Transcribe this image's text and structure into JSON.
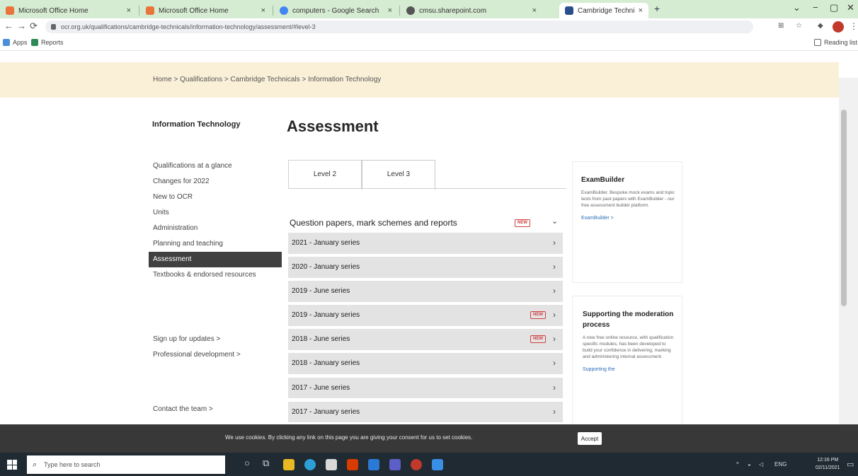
{
  "browser": {
    "tabs": [
      {
        "label": "Microsoft Office Home",
        "fav_color": "#e8743b",
        "active": false
      },
      {
        "label": "Microsoft Office Home",
        "fav_color": "#e8743b",
        "active": false
      },
      {
        "label": "computers - Google Search",
        "fav_color": "#4285f4",
        "active": false
      },
      {
        "label": "cmsu.sharepoint.com",
        "fav_color": "#555555",
        "active": false
      },
      {
        "label": "Cambridge Technicals - Informa",
        "fav_color": "#2b4e8c",
        "active": true
      }
    ],
    "close_glyph": "×",
    "new_tab_glyph": "+",
    "address": "ocr.org.uk/qualifications/cambridge-technicals/information-technology/assessment/#level-3",
    "bookmarks": [
      {
        "label": "Apps",
        "icon": "apps-grid-icon"
      },
      {
        "label": "Reports",
        "icon": "reports-icon"
      }
    ],
    "reading_list": "Reading list"
  },
  "page": {
    "breadcrumb": "Home > Qualifications > Cambridge Technicals > Information Technology",
    "sidenav_title": "Information Technology",
    "sidenav_items": [
      {
        "label": "Qualifications at a glance",
        "active": false
      },
      {
        "label": "Changes for 2022",
        "active": false
      },
      {
        "label": "New to OCR",
        "active": false
      },
      {
        "label": "Units",
        "active": false
      },
      {
        "label": "Administration",
        "active": false
      },
      {
        "label": "Planning and teaching",
        "active": false
      },
      {
        "label": "Assessment",
        "active": true
      },
      {
        "label": "Textbooks & endorsed resources",
        "active": false
      }
    ],
    "side_links": [
      "Sign up for updates >",
      "Professional development >",
      "Contact the team >"
    ],
    "title": "Assessment",
    "level_tabs": [
      {
        "label": "Level 2",
        "active": false
      },
      {
        "label": "Level 3",
        "active": true
      }
    ],
    "section_header": "Question papers, mark schemes and reports",
    "new_badge": "NEW",
    "series": [
      {
        "label": "2021 - January series",
        "is_new": false
      },
      {
        "label": "2020 - January series",
        "is_new": false
      },
      {
        "label": "2019 - June series",
        "is_new": false
      },
      {
        "label": "2019 - January series",
        "is_new": true
      },
      {
        "label": "2018 - June series",
        "is_new": true
      },
      {
        "label": "2018 - January series",
        "is_new": false
      },
      {
        "label": "2017 - June series",
        "is_new": false
      },
      {
        "label": "2017 - January series",
        "is_new": false
      }
    ],
    "cards": [
      {
        "title": "ExamBuilder",
        "body": "ExamBuilder. Bespoke mock exams and topic tests from past papers with ExamBuilder - our free assessment builder platform.",
        "link": "ExamBuilder >"
      },
      {
        "title": "Supporting the moderation process",
        "body": "A new free online resource, with qualification specific modules, has been developed to build your confidence in delivering, marking and administering internal assessment.",
        "link": "Supporting the"
      }
    ],
    "cookie_text": "We use cookies. By clicking any link on this page you are giving your consent for us to set cookies.",
    "cookie_accept": "Accept"
  },
  "taskbar": {
    "search_placeholder": "Type here to search",
    "apps": [
      {
        "name": "file-explorer-icon",
        "color": "#e8b923"
      },
      {
        "name": "edge-icon",
        "color": "#2d9fd8"
      },
      {
        "name": "store-icon",
        "color": "#d8d8d8"
      },
      {
        "name": "office-icon",
        "color": "#d83b01"
      },
      {
        "name": "mail-icon",
        "color": "#2a7ad5"
      },
      {
        "name": "teams-icon",
        "color": "#5b5fc7"
      },
      {
        "name": "chrome-icon",
        "color": "#c0392b"
      },
      {
        "name": "paint-icon",
        "color": "#3a8ee6"
      }
    ],
    "lang": "ENG",
    "time": "12:16 PM",
    "date": "02/11/2021"
  }
}
